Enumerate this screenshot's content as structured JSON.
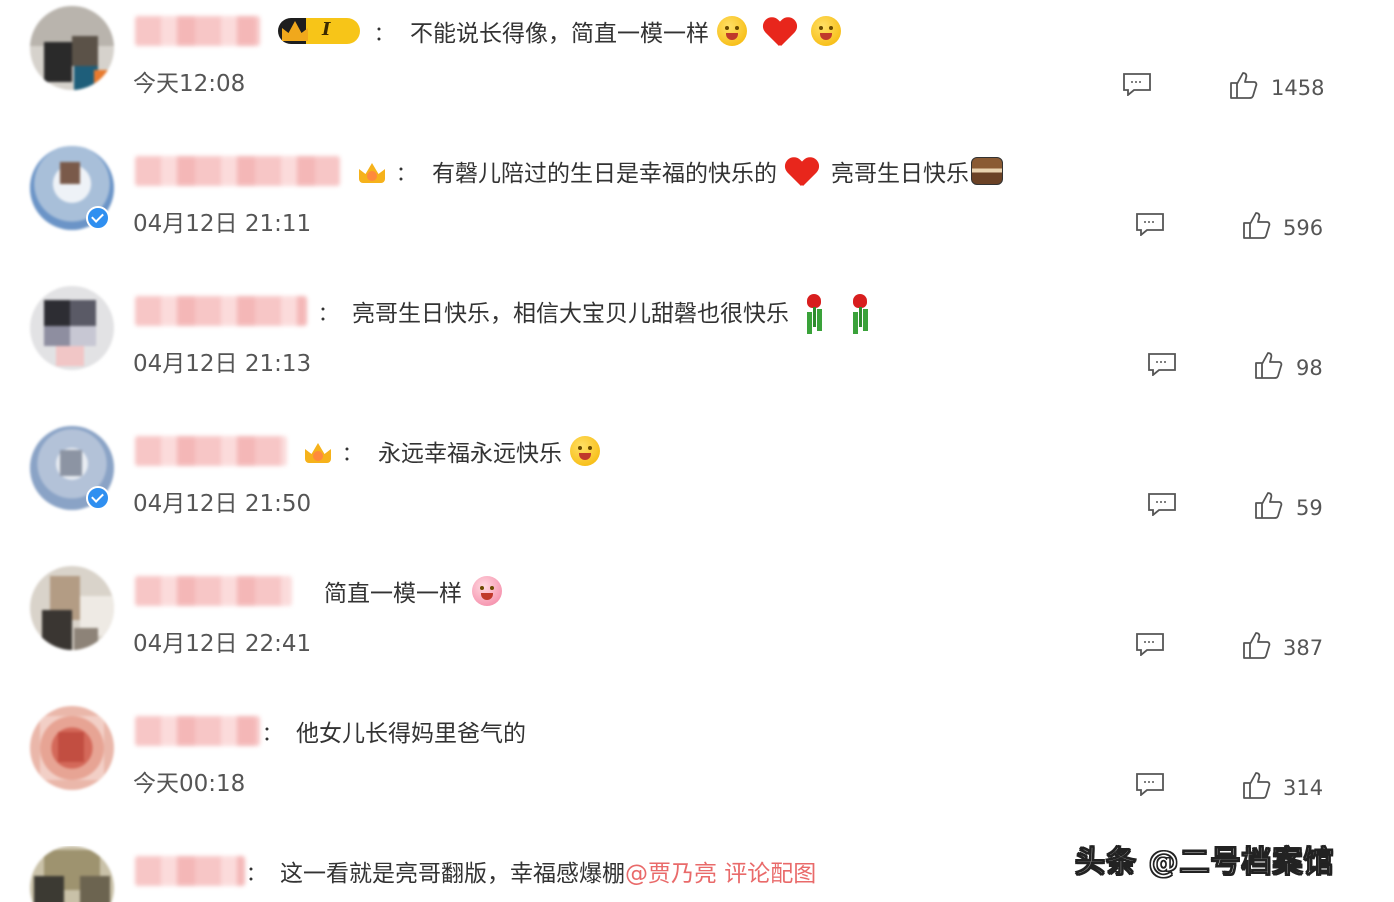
{
  "comments": [
    {
      "text": "不能说长得像，简直一模一样",
      "time": "今天12:08",
      "likes": "1458",
      "vip_level": "I"
    },
    {
      "text": "有磬儿陪过的生日是幸福的快乐的",
      "text2": "亮哥生日快乐",
      "time": "04月12日 21:11",
      "likes": "596"
    },
    {
      "text": "亮哥生日快乐，相信大宝贝儿甜磬也很快乐",
      "time": "04月12日 21:13",
      "likes": "98"
    },
    {
      "text": "永远幸福永远快乐",
      "time": "04月12日 21:50",
      "likes": "59"
    },
    {
      "text": "简直一模一样",
      "time": "04月12日 22:41",
      "likes": "387"
    },
    {
      "text": "他女儿长得妈里爸气的",
      "time": "今天00:18",
      "likes": "314"
    },
    {
      "text": "这一看就是亮哥翻版，幸福感爆棚",
      "mention": "@贾乃亮 评论配图"
    }
  ],
  "ui": {
    "colon": "："
  },
  "icons": {
    "reply": "reply-icon",
    "like": "thumbs-up-icon"
  },
  "watermark": "头条 @二号档案馆",
  "colors": {
    "mention": "#e96a6a",
    "verified": "#2f8ff0"
  }
}
